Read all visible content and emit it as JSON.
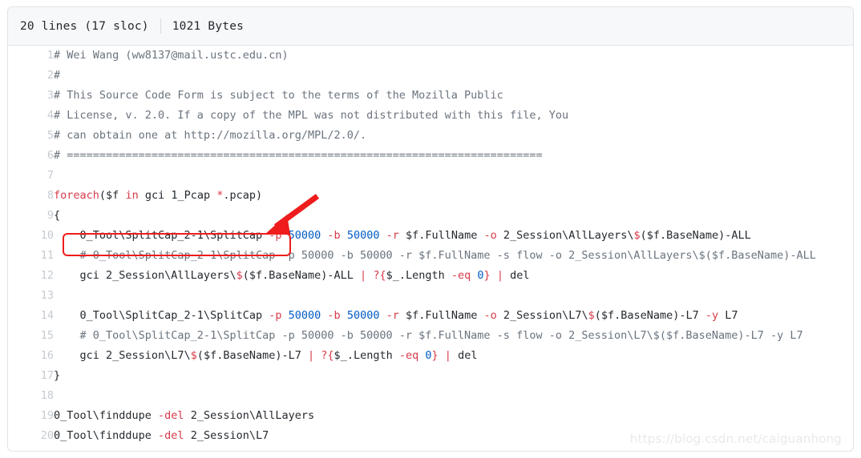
{
  "header": {
    "lines_label": "20 lines (17 sloc)",
    "size_label": "1021 Bytes"
  },
  "annotations": {
    "highlight_box_color": "#ee1c1c",
    "arrow_color": "#ee1c1c",
    "highlighted_line": 8
  },
  "watermark": {
    "text": "https://blog.csdn.net/caiguanhong"
  },
  "colors": {
    "comment": "#6a737d",
    "keyword": "#d73a49",
    "number": "#005cc5",
    "text": "#24292e",
    "line_number": "#c6cbd1",
    "header_bg": "#f6f8fa",
    "border": "#e1e4e8"
  },
  "code": {
    "lines": [
      {
        "n": "1",
        "tokens": [
          {
            "t": "# Wei Wang (ww8137@mail.ustc.edu.cn)",
            "c": "tok-comment"
          }
        ]
      },
      {
        "n": "2",
        "tokens": [
          {
            "t": "#",
            "c": "tok-comment"
          }
        ]
      },
      {
        "n": "3",
        "tokens": [
          {
            "t": "# This Source Code Form is subject to the terms of the Mozilla Public",
            "c": "tok-comment"
          }
        ]
      },
      {
        "n": "4",
        "tokens": [
          {
            "t": "# License, v. 2.0. If a copy of the MPL was not distributed with this file, You",
            "c": "tok-comment"
          }
        ]
      },
      {
        "n": "5",
        "tokens": [
          {
            "t": "# can obtain one at http://mozilla.org/MPL/2.0/.",
            "c": "tok-comment"
          }
        ]
      },
      {
        "n": "6",
        "tokens": [
          {
            "t": "# =========================================================================",
            "c": "tok-comment"
          }
        ]
      },
      {
        "n": "7",
        "tokens": []
      },
      {
        "n": "8",
        "tokens": [
          {
            "t": "foreach",
            "c": "tok-kw"
          },
          {
            "t": "(",
            "c": "tok-plain"
          },
          {
            "t": "$f",
            "c": "tok-var"
          },
          {
            "t": " ",
            "c": "tok-plain"
          },
          {
            "t": "in",
            "c": "tok-kw"
          },
          {
            "t": " gci 1_Pcap ",
            "c": "tok-plain"
          },
          {
            "t": "*",
            "c": "tok-op"
          },
          {
            "t": ".pcap)",
            "c": "tok-plain"
          }
        ]
      },
      {
        "n": "9",
        "tokens": [
          {
            "t": "{",
            "c": "tok-plain"
          }
        ]
      },
      {
        "n": "10",
        "tokens": [
          {
            "t": "    0_Tool\\SplitCap_2-1\\SplitCap ",
            "c": "tok-plain"
          },
          {
            "t": "-p",
            "c": "tok-op"
          },
          {
            "t": " ",
            "c": "tok-plain"
          },
          {
            "t": "50000",
            "c": "tok-num"
          },
          {
            "t": " ",
            "c": "tok-plain"
          },
          {
            "t": "-b",
            "c": "tok-op"
          },
          {
            "t": " ",
            "c": "tok-plain"
          },
          {
            "t": "50000",
            "c": "tok-num"
          },
          {
            "t": " ",
            "c": "tok-plain"
          },
          {
            "t": "-r",
            "c": "tok-op"
          },
          {
            "t": " $f.FullName ",
            "c": "tok-plain"
          },
          {
            "t": "-o",
            "c": "tok-op"
          },
          {
            "t": " 2_Session\\AllLayers\\",
            "c": "tok-plain"
          },
          {
            "t": "$",
            "c": "tok-op"
          },
          {
            "t": "($f.BaseName)-ALL",
            "c": "tok-plain"
          }
        ]
      },
      {
        "n": "11",
        "tokens": [
          {
            "t": "    # 0_Tool\\SplitCap_2-1\\SplitCap -p 50000 -b 50000 -r $f.FullName -s flow -o 2_Session\\AllLayers\\$($f.BaseName)-ALL",
            "c": "tok-comment"
          }
        ]
      },
      {
        "n": "12",
        "tokens": [
          {
            "t": "    gci 2_Session\\AllLayers\\",
            "c": "tok-plain"
          },
          {
            "t": "$",
            "c": "tok-op"
          },
          {
            "t": "($f.BaseName)-ALL ",
            "c": "tok-plain"
          },
          {
            "t": "|",
            "c": "tok-op"
          },
          {
            "t": " ",
            "c": "tok-plain"
          },
          {
            "t": "?{",
            "c": "tok-op"
          },
          {
            "t": "$_",
            "c": "tok-var"
          },
          {
            "t": ".Length ",
            "c": "tok-plain"
          },
          {
            "t": "-eq",
            "c": "tok-op"
          },
          {
            "t": " ",
            "c": "tok-plain"
          },
          {
            "t": "0",
            "c": "tok-num"
          },
          {
            "t": "}",
            "c": "tok-op"
          },
          {
            "t": " ",
            "c": "tok-plain"
          },
          {
            "t": "|",
            "c": "tok-op"
          },
          {
            "t": " del",
            "c": "tok-plain"
          }
        ]
      },
      {
        "n": "13",
        "tokens": []
      },
      {
        "n": "14",
        "tokens": [
          {
            "t": "    0_Tool\\SplitCap_2-1\\SplitCap ",
            "c": "tok-plain"
          },
          {
            "t": "-p",
            "c": "tok-op"
          },
          {
            "t": " ",
            "c": "tok-plain"
          },
          {
            "t": "50000",
            "c": "tok-num"
          },
          {
            "t": " ",
            "c": "tok-plain"
          },
          {
            "t": "-b",
            "c": "tok-op"
          },
          {
            "t": " ",
            "c": "tok-plain"
          },
          {
            "t": "50000",
            "c": "tok-num"
          },
          {
            "t": " ",
            "c": "tok-plain"
          },
          {
            "t": "-r",
            "c": "tok-op"
          },
          {
            "t": " $f.FullName ",
            "c": "tok-plain"
          },
          {
            "t": "-o",
            "c": "tok-op"
          },
          {
            "t": " 2_Session\\L7\\",
            "c": "tok-plain"
          },
          {
            "t": "$",
            "c": "tok-op"
          },
          {
            "t": "($f.BaseName)-L7 ",
            "c": "tok-plain"
          },
          {
            "t": "-y",
            "c": "tok-op"
          },
          {
            "t": " L7",
            "c": "tok-plain"
          }
        ]
      },
      {
        "n": "15",
        "tokens": [
          {
            "t": "    # 0_Tool\\SplitCap_2-1\\SplitCap -p 50000 -b 50000 -r $f.FullName -s flow -o 2_Session\\L7\\$($f.BaseName)-L7 -y L7",
            "c": "tok-comment"
          }
        ]
      },
      {
        "n": "16",
        "tokens": [
          {
            "t": "    gci 2_Session\\L7\\",
            "c": "tok-plain"
          },
          {
            "t": "$",
            "c": "tok-op"
          },
          {
            "t": "($f.BaseName)-L7 ",
            "c": "tok-plain"
          },
          {
            "t": "|",
            "c": "tok-op"
          },
          {
            "t": " ",
            "c": "tok-plain"
          },
          {
            "t": "?{",
            "c": "tok-op"
          },
          {
            "t": "$_",
            "c": "tok-var"
          },
          {
            "t": ".Length ",
            "c": "tok-plain"
          },
          {
            "t": "-eq",
            "c": "tok-op"
          },
          {
            "t": " ",
            "c": "tok-plain"
          },
          {
            "t": "0",
            "c": "tok-num"
          },
          {
            "t": "}",
            "c": "tok-op"
          },
          {
            "t": " ",
            "c": "tok-plain"
          },
          {
            "t": "|",
            "c": "tok-op"
          },
          {
            "t": " del",
            "c": "tok-plain"
          }
        ]
      },
      {
        "n": "17",
        "tokens": [
          {
            "t": "}",
            "c": "tok-plain"
          }
        ]
      },
      {
        "n": "18",
        "tokens": []
      },
      {
        "n": "19",
        "tokens": [
          {
            "t": "0_Tool\\finddupe ",
            "c": "tok-plain"
          },
          {
            "t": "-del",
            "c": "tok-op"
          },
          {
            "t": " 2_Session\\AllLayers",
            "c": "tok-plain"
          }
        ]
      },
      {
        "n": "20",
        "tokens": [
          {
            "t": "0_Tool\\finddupe ",
            "c": "tok-plain"
          },
          {
            "t": "-del",
            "c": "tok-op"
          },
          {
            "t": " 2_Session\\L7",
            "c": "tok-plain"
          }
        ]
      }
    ]
  }
}
